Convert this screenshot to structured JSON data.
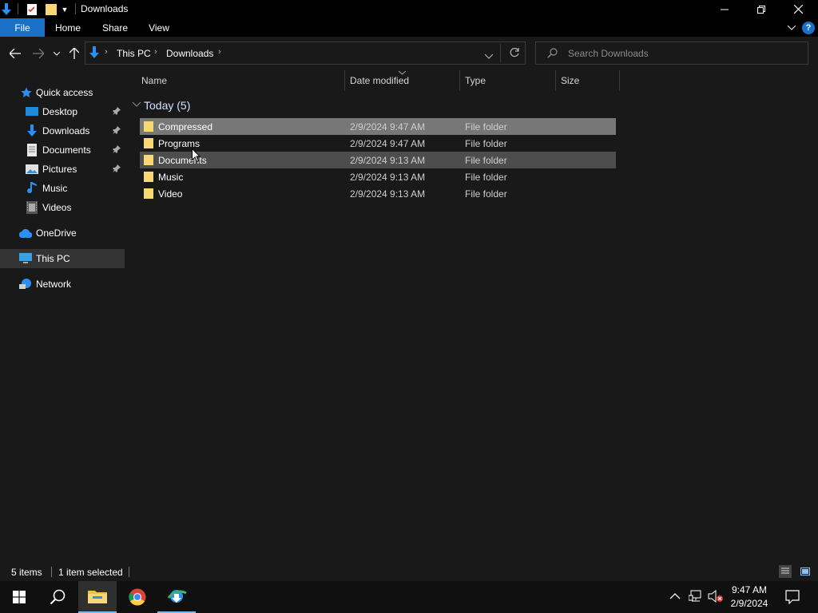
{
  "window": {
    "title": "Downloads",
    "caption_buttons": [
      "minimize",
      "restore",
      "close"
    ]
  },
  "ribbon": {
    "tabs": [
      "File",
      "Home",
      "Share",
      "View"
    ],
    "help_label": "?"
  },
  "address": {
    "crumbs": [
      "This PC",
      "Downloads"
    ],
    "search_placeholder": "Search Downloads"
  },
  "sidebar": {
    "items": [
      {
        "label": "Quick access",
        "icon": "star-icon"
      },
      {
        "label": "Desktop",
        "icon": "desktop-icon",
        "pinned": true
      },
      {
        "label": "Downloads",
        "icon": "download-arrow-icon",
        "pinned": true
      },
      {
        "label": "Documents",
        "icon": "documents-icon",
        "pinned": true
      },
      {
        "label": "Pictures",
        "icon": "pictures-icon",
        "pinned": true
      },
      {
        "label": "Music",
        "icon": "music-note-icon"
      },
      {
        "label": "Videos",
        "icon": "videos-icon"
      },
      {
        "label": "OneDrive",
        "icon": "cloud-icon"
      },
      {
        "label": "This PC",
        "icon": "computer-icon",
        "selected": true
      },
      {
        "label": "Network",
        "icon": "network-icon"
      }
    ]
  },
  "content": {
    "columns": [
      "Name",
      "Date modified",
      "Type",
      "Size"
    ],
    "group_label": "Today (5)",
    "files": [
      {
        "name": "Compressed",
        "date": "2/9/2024 9:47 AM",
        "type": "File folder",
        "state": "selected"
      },
      {
        "name": "Programs",
        "date": "2/9/2024 9:47 AM",
        "type": "File folder",
        "state": "normal"
      },
      {
        "name": "Documents",
        "date": "2/9/2024 9:13 AM",
        "type": "File folder",
        "state": "hovered"
      },
      {
        "name": "Music",
        "date": "2/9/2024 9:13 AM",
        "type": "File folder",
        "state": "normal"
      },
      {
        "name": "Video",
        "date": "2/9/2024 9:13 AM",
        "type": "File folder",
        "state": "normal"
      }
    ]
  },
  "status": {
    "item_count": "5 items",
    "selection": "1 item selected"
  },
  "taskbar": {
    "time": "9:47 AM",
    "date": "2/9/2024"
  },
  "colors": {
    "accent": "#1a6fc7",
    "folder": "#f8d775",
    "selected_row": "#777777",
    "hover_row": "#4d4d4d"
  }
}
